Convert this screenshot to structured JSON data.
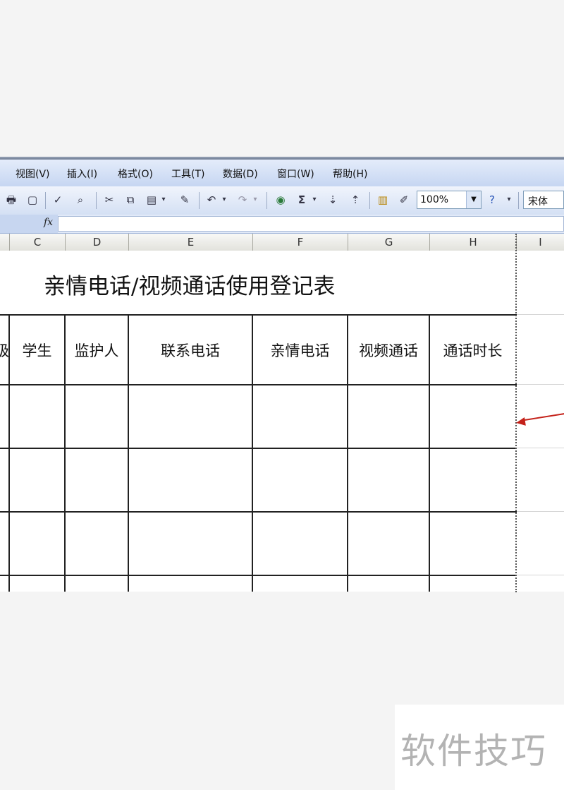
{
  "menubar": {
    "items": [
      {
        "label": "视图(V)"
      },
      {
        "label": "插入(I)"
      },
      {
        "label": "格式(O)"
      },
      {
        "label": "工具(T)"
      },
      {
        "label": "数据(D)"
      },
      {
        "label": "窗口(W)"
      },
      {
        "label": "帮助(H)"
      }
    ]
  },
  "toolbar": {
    "zoom": "100%",
    "font_name": "宋体",
    "sum_glyph": "Σ"
  },
  "formula_bar": {
    "fx_label": "fx"
  },
  "columns": [
    "C",
    "D",
    "E",
    "F",
    "G",
    "H",
    "I"
  ],
  "sheet": {
    "title": "亲情电话/视频通话使用登记表",
    "headers": [
      "级",
      "学生",
      "监护人",
      "联系电话",
      "亲情电话",
      "视频通话",
      "通话时长"
    ]
  },
  "watermark": "软件技巧",
  "colors": {
    "menubar": "#c6d6f2",
    "annotation_arrow": "#c4221a"
  }
}
